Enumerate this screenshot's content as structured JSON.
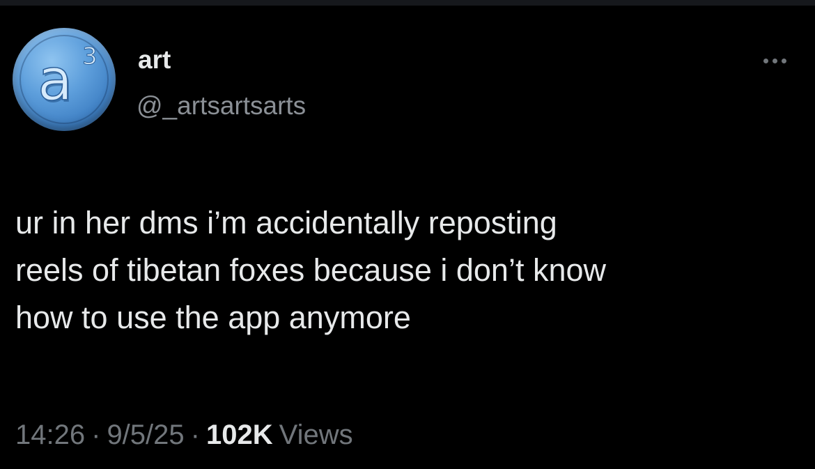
{
  "author": {
    "display_name": "art",
    "handle": "@_artsartsarts",
    "avatar": {
      "letter": "a",
      "superscript": "3",
      "color": "#5e9fdc"
    }
  },
  "post": {
    "text": "ur in her dms i’m accidentally reposting\nreels of tibetan foxes because i don’t know\nhow to use the app anymore",
    "time": "14:26",
    "date": "9/5/25",
    "separator": "·",
    "views_count": "102K",
    "views_label": "Views"
  },
  "icons": {
    "more": "more-horizontal-icon"
  },
  "colors": {
    "background": "#000000",
    "primary_text": "#e7e9ea",
    "secondary_text": "#71767b"
  }
}
